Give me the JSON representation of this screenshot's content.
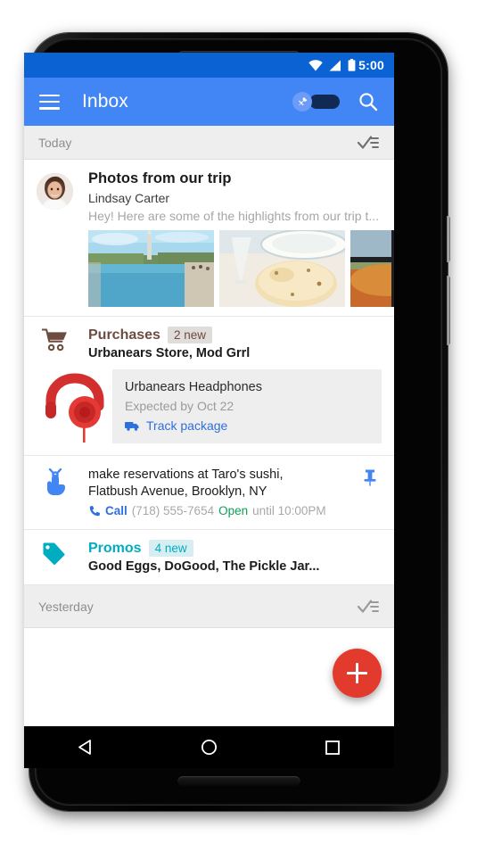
{
  "status_bar": {
    "time": "5:00",
    "icons": [
      "wifi-icon",
      "cell-signal-icon",
      "battery-icon"
    ],
    "bg_color": "#0b63d3"
  },
  "app_bar": {
    "title": "Inbox",
    "menu_icon": "hamburger-menu-icon",
    "pin_toggle_icon": "pin-icon",
    "pin_toggle_state": "off",
    "search_icon": "search-icon",
    "bg_color": "#4285f4"
  },
  "sections": {
    "today": {
      "label": "Today",
      "sweep_icon": "sweep-select-icon"
    },
    "yesterday": {
      "label": "Yesterday",
      "sweep_icon": "sweep-select-icon"
    }
  },
  "messages": {
    "photos": {
      "avatar": "sender-avatar",
      "subject": "Photos from our trip",
      "sender": "Lindsay Carter",
      "snippet": "Hey! Here are some of the highlights from our trip t...",
      "thumbnails": [
        {
          "name": "photo-washington-monument-reflecting-pool"
        },
        {
          "name": "photo-bread-on-plate"
        },
        {
          "name": "photo-autumn-window-view"
        }
      ]
    },
    "purchases": {
      "icon": "shopping-cart-icon",
      "category": "Purchases",
      "badge": "2 new",
      "badge_color": "#6d4c41",
      "senders": "Urbanears Store, Mod Grrl",
      "product": {
        "image": "red-headphones-image",
        "title": "Urbanears Headphones",
        "eta": "Expected by Oct 22",
        "track_icon": "truck-icon",
        "track_label": "Track package"
      }
    },
    "reminder": {
      "icon": "reminder-finger-string-icon",
      "line1": "make reservations at Taro's sushi,",
      "line2": "Flatbush Avenue, Brooklyn, NY",
      "call_icon": "phone-icon",
      "call_label": "Call",
      "phone": "(718) 555-7654",
      "open_label": "Open",
      "hours": "until 10:00PM",
      "pin_icon": "pushpin-icon",
      "pin_color": "#4285f4"
    },
    "promos": {
      "icon": "price-tag-icon",
      "icon_color": "#00acc1",
      "category": "Promos",
      "badge": "4 new",
      "senders": "Good Eggs, DoGood, The Pickle Jar..."
    }
  },
  "fab": {
    "icon": "plus-icon",
    "label": "Compose",
    "color": "#e23b2e"
  },
  "nav_bar": {
    "back": "back-triangle-icon",
    "home": "home-circle-icon",
    "recents": "recents-square-icon"
  }
}
